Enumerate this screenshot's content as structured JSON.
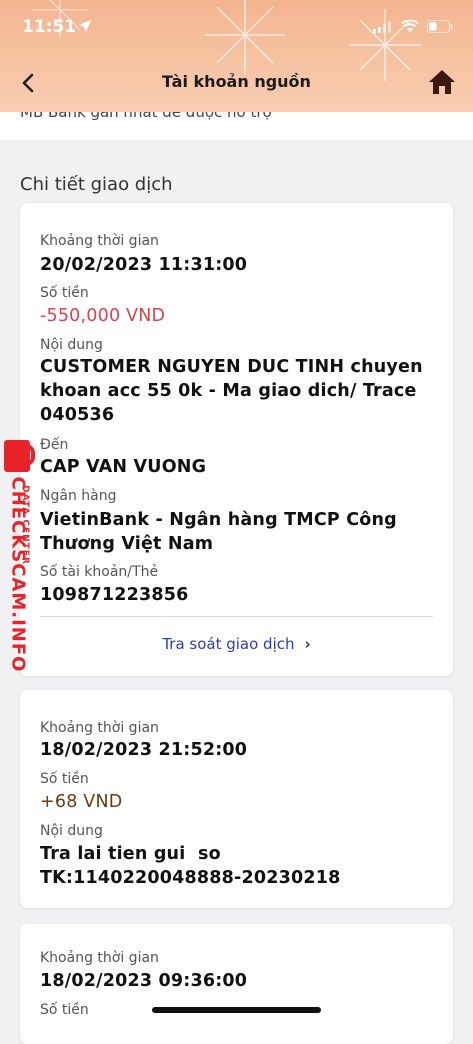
{
  "status_bar": {
    "time": "11:51"
  },
  "nav": {
    "title": "Tài khoản nguồn"
  },
  "notice": {
    "text": "MB Bank gần nhất để được hỗ trợ"
  },
  "section": {
    "title": "Chi tiết giao dịch"
  },
  "transactions": [
    {
      "time_label": "Khoảng thời gian",
      "time_value": "20/02/2023 11:31:00",
      "amount_label": "Số tiền",
      "amount_value": "-550,000 VND",
      "content_label": "Nội dung",
      "content_value": "CUSTOMER NGUYEN DUC TINH chuyen khoan acc 55 0k - Ma giao dich/ Trace 040536",
      "to_label": "Đến",
      "to_value": "CAP VAN VUONG",
      "bank_label": "Ngân hàng",
      "bank_value": "VietinBank - Ngân hàng TMCP Công Thương Việt Nam",
      "account_label": "Số tài khoản/Thẻ",
      "account_value": "109871223856",
      "trace_link": "Tra soát giao dịch"
    },
    {
      "time_label": "Khoảng thời gian",
      "time_value": "18/02/2023 21:52:00",
      "amount_label": "Số tiền",
      "amount_value": "+68 VND",
      "content_label": "Nội dung",
      "content_value": "Tra lai tien gui  so TK:1140220048888-20230218"
    },
    {
      "time_label": "Khoảng thời gian",
      "time_value": "18/02/2023 09:36:00",
      "amount_label": "Số tiền"
    }
  ],
  "watermark": {
    "main": "CHECKSCAM.INFO",
    "sub": "DATA CENTER"
  },
  "colors": {
    "negative": "#d9434f",
    "positive": "#6a3a12",
    "link": "#2b3bbd",
    "watermark": "#e8232a"
  }
}
